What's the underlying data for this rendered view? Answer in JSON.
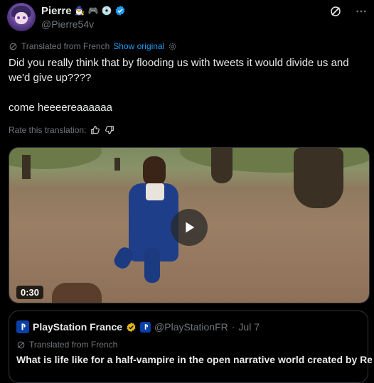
{
  "author": {
    "name": "Pierre",
    "emojis": [
      "🧙‍♂️",
      "🎮",
      "💿"
    ],
    "handle": "@Pierre54v",
    "verified": true
  },
  "header_icons": [
    "grok-icon",
    "more-options-icon"
  ],
  "translation": {
    "label": "Translated from French",
    "link": "Show original"
  },
  "tweet": {
    "text": "Did you really think that by flooding us with tweets it would divide us and we'd give up????\n\ncome heeeereaaaaaa"
  },
  "rate": {
    "label": "Rate this translation:"
  },
  "video": {
    "duration": "0:30"
  },
  "quoted_tweet": {
    "name": "PlayStation France",
    "handle": "@PlayStationFR",
    "separator": "·",
    "date": "Jul 7",
    "translation_label": "Translated from French",
    "text": "What is life like for a half-vampire in the open narrative world created by Rebel"
  },
  "colors": {
    "accent": "#1d9bf0",
    "muted": "#71767b",
    "gold_badge": "#e2b719",
    "background": "#000000"
  }
}
